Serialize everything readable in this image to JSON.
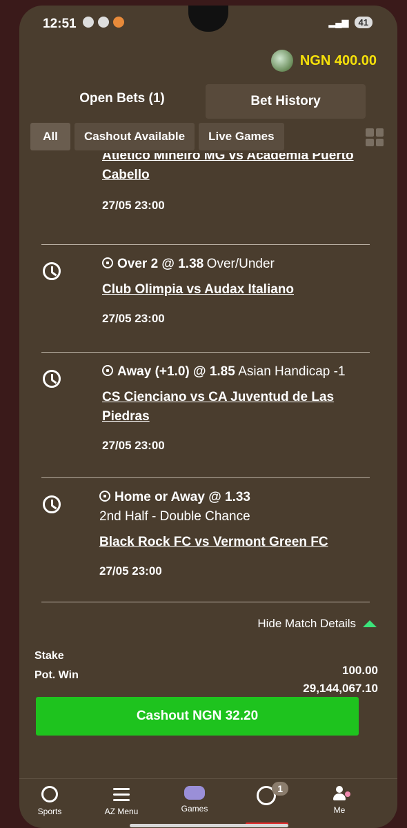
{
  "status_bar": {
    "time": "12:51",
    "battery": "41"
  },
  "header": {
    "balance": "NGN 400.00"
  },
  "top_tabs": {
    "open_bets": "Open Bets (1)",
    "bet_history": "Bet History"
  },
  "filters": {
    "all": "All",
    "cashout": "Cashout Available",
    "live": "Live Games"
  },
  "bets": [
    {
      "match": "Atletico Mineiro MG vs Academia Puerto Cabello",
      "match_visible_line1": "Atletico Mineiro MG vs Academia Puerto",
      "match_visible_line2": "Cabello",
      "date": "27/05 23:00"
    },
    {
      "selection": "Over 2 @ 1.38",
      "market": "Over/Under",
      "match": "Club Olimpia vs Audax Italiano",
      "date": "27/05 23:00"
    },
    {
      "selection": "Away (+1.0) @ 1.85",
      "market": "Asian Handicap -1",
      "match_line1": "CS Cienciano vs CA Juventud de Las",
      "match_line2": "Piedras",
      "date": "27/05 23:00"
    },
    {
      "selection": "Home or Away @ 1.33",
      "market": "2nd Half - Double Chance",
      "match": "Black Rock FC vs Vermont Green FC",
      "date": "27/05 23:00"
    }
  ],
  "details": {
    "hide_label": "Hide Match Details"
  },
  "summary": {
    "stake_label": "Stake",
    "stake_value": "100.00",
    "pot_win_label": "Pot. Win",
    "pot_win_value": "29,144,067.10"
  },
  "cashout": {
    "label": "Cashout NGN 32.20"
  },
  "nav": {
    "sports": "Sports",
    "az_menu": "AZ Menu",
    "games": "Games",
    "cashout_badge": "1",
    "me": "Me"
  },
  "colors": {
    "accent_green": "#1ec31e",
    "balance_yellow": "#f5e00a",
    "bg": "#4a3d2e"
  }
}
